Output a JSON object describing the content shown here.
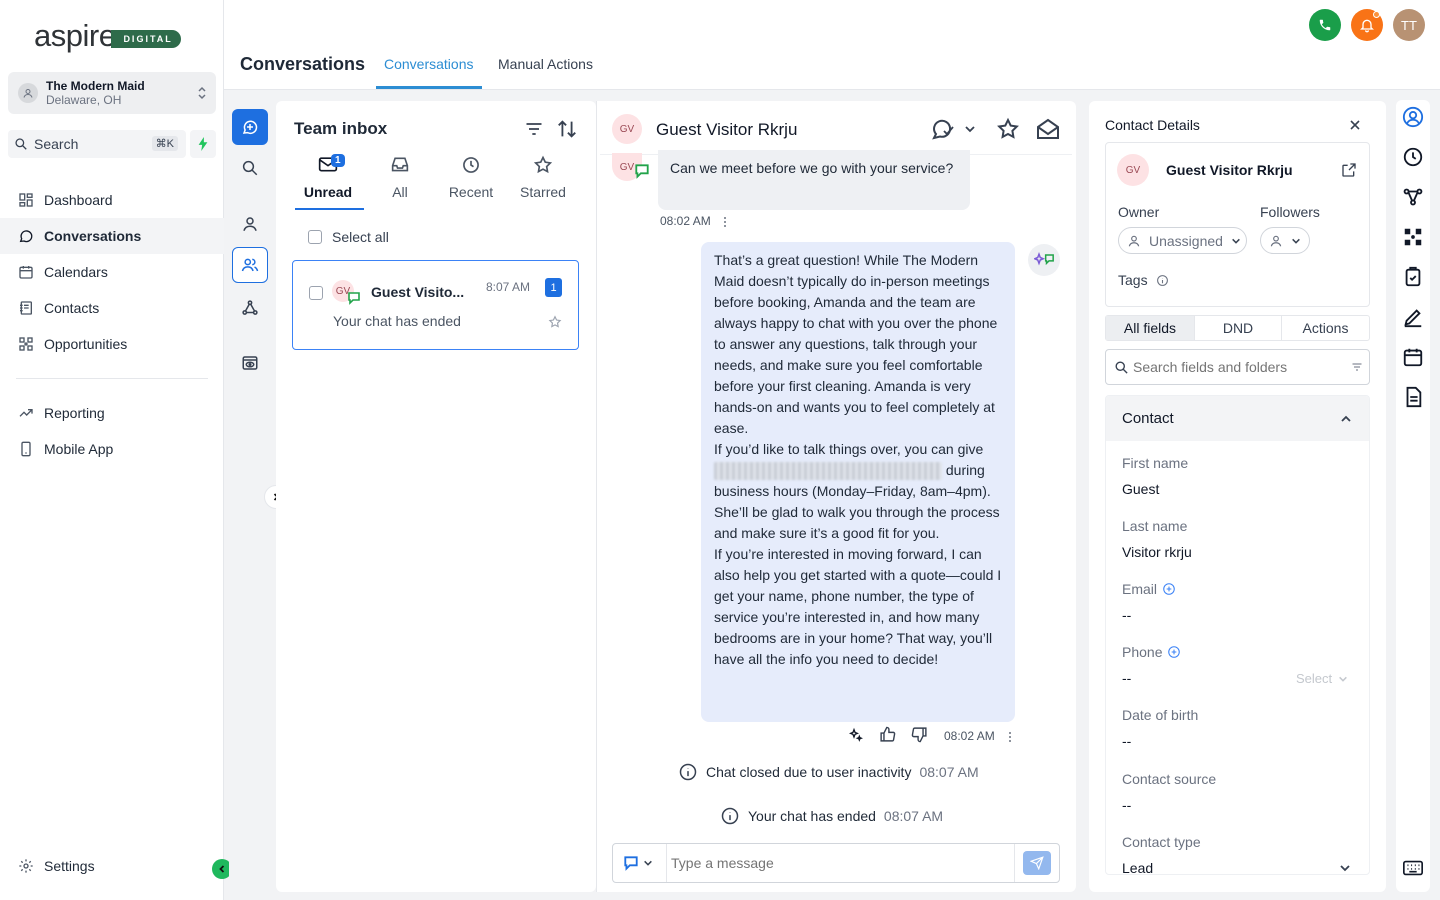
{
  "brand": {
    "logo_word": "aspire",
    "logo_badge": "DIGITAL",
    "accent": "#2c8dd3",
    "brand_green": "#2e6b4a"
  },
  "account": {
    "name": "The Modern Maid",
    "location": "Delaware, OH"
  },
  "search": {
    "label": "Search",
    "shortcut": "⌘K"
  },
  "nav": {
    "dashboard": "Dashboard",
    "conversations": "Conversations",
    "calendars": "Calendars",
    "contacts": "Contacts",
    "opportunities": "Opportunities",
    "reporting": "Reporting",
    "mobile_app": "Mobile App",
    "settings": "Settings"
  },
  "header": {
    "title": "Conversations",
    "tabs": [
      "Conversations",
      "Manual Actions"
    ],
    "user_initials": "TT"
  },
  "inbox": {
    "title": "Team inbox",
    "tabs": {
      "unread": "Unread",
      "all": "All",
      "recent": "Recent",
      "starred": "Starred"
    },
    "unread_badge": "1",
    "select_all": "Select all",
    "item": {
      "initials": "GV",
      "name": "Guest Visito...",
      "time": "8:07 AM",
      "count": "1",
      "preview": "Your chat has ended"
    }
  },
  "chat": {
    "contact_initials": "GV",
    "contact_name": "Guest Visitor Rkrju",
    "incoming": {
      "text": "Can we meet before we go with your service?",
      "time": "08:02 AM"
    },
    "outgoing": {
      "p1": "That’s a great question! While The Modern Maid doesn’t typically do in-person meetings before booking, Amanda and the team are always happy to chat with you over the phone to answer any questions, talk through your needs, and make sure you feel comfortable before your first cleaning. Amanda is very hands-on and wants you to feel completely at ease.",
      "p2a": "If you’d like to talk things over, you can give",
      "p2b": "during business hours (Monday–Friday, 8am–4pm). She’ll be glad to walk you through the process and make sure it’s a good fit for you.",
      "p3": "If you’re interested in moving forward, I can also help you get started with a quote—could I get your name, phone number, the type of service you’re interested in, and how many bedrooms are in your home? That way, you’ll have all the info you need to decide!",
      "time": "08:02 AM"
    },
    "system": [
      {
        "text": "Chat closed due to user inactivity",
        "time": "08:07 AM"
      },
      {
        "text": "Your chat has ended",
        "time": "08:07 AM"
      }
    ],
    "composer_placeholder": "Type a message"
  },
  "details": {
    "title": "Contact Details",
    "initials": "GV",
    "name": "Guest Visitor Rkrju",
    "owner_label": "Owner",
    "owner_value": "Unassigned",
    "followers_label": "Followers",
    "tags_label": "Tags",
    "tabs": [
      "All fields",
      "DND",
      "Actions"
    ],
    "search_placeholder": "Search fields and folders",
    "section": "Contact",
    "fields": {
      "first_name": {
        "label": "First name",
        "value": "Guest"
      },
      "last_name": {
        "label": "Last name",
        "value": "Visitor rkrju"
      },
      "email": {
        "label": "Email",
        "value": "--"
      },
      "phone": {
        "label": "Phone",
        "value": "--",
        "select": "Select"
      },
      "dob": {
        "label": "Date of birth",
        "value": "--"
      },
      "source": {
        "label": "Contact source",
        "value": "--"
      },
      "type": {
        "label": "Contact type",
        "value": "Lead"
      }
    }
  }
}
